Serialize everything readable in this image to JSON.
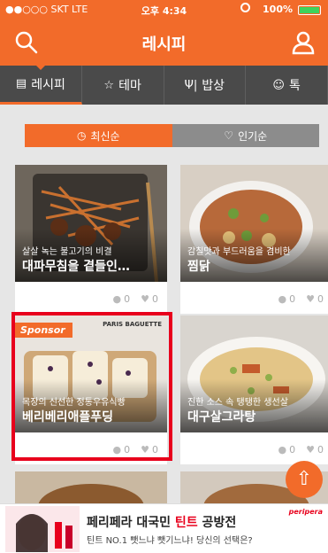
{
  "status": {
    "carrier": "●●○○○ SKT  LTE",
    "time": "오후 4:34",
    "battery": "100%"
  },
  "header": {
    "title": "레시피"
  },
  "tabs": [
    {
      "label": "레시피",
      "icon": "recipe-book-icon"
    },
    {
      "label": "테마",
      "icon": "star-icon"
    },
    {
      "label": "밥상",
      "icon": "utensils-icon"
    },
    {
      "label": "톡",
      "icon": "chat-icon"
    }
  ],
  "sort": {
    "latest": "최신순",
    "popular": "인기순"
  },
  "cards": [
    {
      "subtitle": "살살 녹는 불고기의 비결",
      "name": "대파무침을 곁들인…",
      "comments": "0",
      "likes": "0"
    },
    {
      "subtitle": "감칠맛과 부드러움을 겸비한",
      "name": "찜닭",
      "comments": "0",
      "likes": "0"
    },
    {
      "subtitle": "목장의 신선한 정통우유식빵",
      "name": "베리베리애플푸딩",
      "comments": "0",
      "likes": "0",
      "badge": "Sponsor",
      "brand": "PARIS BAGUETTE"
    },
    {
      "subtitle": "진한 소스 속 탱탱한 생선살",
      "name": "대구살그라탕",
      "comments": "0",
      "likes": "0"
    }
  ],
  "ad": {
    "line1_a": "페리페라 대국민 ",
    "line1_b": "틴트",
    "line1_c": " 공방전",
    "line2": "틴트 NO.1 뺏느냐 뺏기느냐! 당신의 선택은?",
    "brand": "peripera"
  },
  "colors": {
    "accent": "#f26b2a",
    "tabbar": "#4a4a4a",
    "highlight": "#e8001c"
  }
}
